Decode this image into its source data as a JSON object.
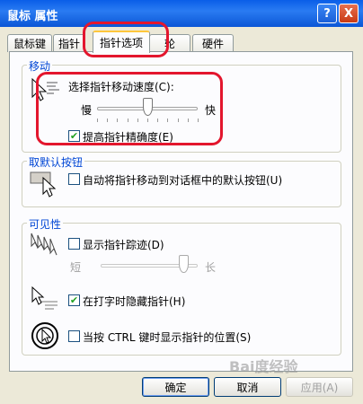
{
  "window": {
    "title": "鼠标 属性"
  },
  "titlebar_buttons": {
    "help": "?",
    "close": "X"
  },
  "tabs": [
    {
      "label": "鼠标键"
    },
    {
      "label": "指针"
    },
    {
      "label": "指针选项"
    },
    {
      "label": "轮"
    },
    {
      "label": "硬件"
    }
  ],
  "motion": {
    "legend": "移动",
    "speed_label": "选择指针移动速度(C):",
    "slow": "慢",
    "fast": "快",
    "speed_level": 0.5,
    "precision_label": "提高指针精确度(E)",
    "precision_checked": true
  },
  "snap": {
    "legend": "取默认按钮",
    "label": "自动将指针移动到对话框中的默认按钮(U)",
    "checked": false
  },
  "visibility": {
    "legend": "可见性",
    "trails_label": "显示指针踪迹(D)",
    "trails_checked": false,
    "short": "短",
    "long": "长",
    "trail_level": 0.85,
    "hide_label": "在打字时隐藏指针(H)",
    "hide_checked": true,
    "ctrl_label": "当按 CTRL 键时显示指针的位置(S)",
    "ctrl_checked": false
  },
  "buttons": {
    "ok": "确定",
    "cancel": "取消",
    "apply": "应用(A)"
  },
  "watermark": "Bai度经验",
  "colors": {
    "annotation": "#e3162d",
    "legend": "#0046d5",
    "titlebar": "#0a5ee8"
  }
}
